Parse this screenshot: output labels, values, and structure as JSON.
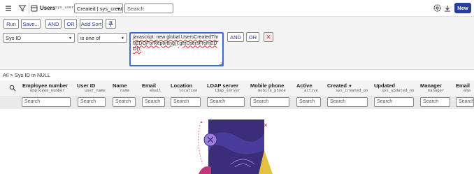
{
  "topbar": {
    "title": "Users",
    "table_name": "sys_user",
    "sort_select": "Created | sys_create",
    "search_placeholder": "Search",
    "new_label": "New"
  },
  "toolbar": {
    "run": "Run",
    "save": "Save...",
    "and": "AND",
    "or": "OR",
    "add_sort": "Add Sort"
  },
  "condition": {
    "field": "Sys ID",
    "operator": "is one of",
    "value": "javascript: new global.UsersCreatedThruEDOForReporting().getUsersFromEDO();",
    "and": "AND",
    "or": "OR"
  },
  "breadcrumb": "All > Sys ID in NULL",
  "columns": [
    {
      "label": "Employee number",
      "field": "employee_number"
    },
    {
      "label": "User ID",
      "field": "user_name"
    },
    {
      "label": "Name",
      "field": "name"
    },
    {
      "label": "Email",
      "field": "email"
    },
    {
      "label": "Location",
      "field": "location"
    },
    {
      "label": "LDAP server",
      "field": "ldap_server"
    },
    {
      "label": "Mobile phone",
      "field": "mobile_phone"
    },
    {
      "label": "Active",
      "field": "active"
    },
    {
      "label": "Created",
      "field": "sys_created_on",
      "sort": "▼"
    },
    {
      "label": "Updated",
      "field": "sys_updated_on"
    },
    {
      "label": "Manager",
      "field": "manager"
    },
    {
      "label": "Email",
      "field": "ema"
    }
  ],
  "column_search_placeholder": "Search",
  "colors": {
    "primary": "#293e96",
    "focus": "#3e6bd6",
    "illus_dark": "#3b2d7a",
    "illus_accent": "#e6c13f"
  }
}
